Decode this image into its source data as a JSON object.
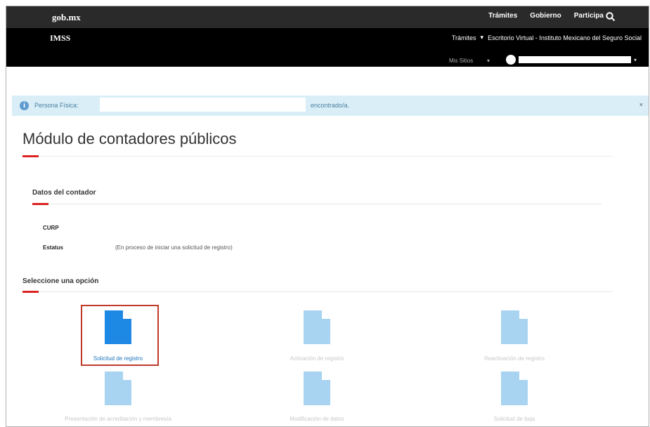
{
  "header": {
    "brand": "gob.mx",
    "nav": [
      "Trámites",
      "Gobierno",
      "Participa"
    ],
    "search_icon": "search-icon"
  },
  "subheader": {
    "title": "IMSS",
    "nav_item": "Trámites",
    "nav_caret": "▾",
    "site_title": "Escritorio Virtual - Instituto Mexicano del Seguro Social",
    "mis_sitios": "Mis Sitios",
    "user_caret": "▾"
  },
  "alert": {
    "icon": "info-icon",
    "label": "Persona Física:",
    "field_value": "",
    "suffix": "encontrado/a.",
    "close": "×"
  },
  "page": {
    "title": "Módulo de contadores públicos"
  },
  "datos": {
    "heading": "Datos del contador",
    "curp_label": "CURP",
    "curp_value": "",
    "estatus_label": "Estatus",
    "estatus_value": "(En proceso de iniciar una solicitud de registro)"
  },
  "options": {
    "heading": "Seleccione una opción",
    "items": [
      {
        "label": "Solicitud de registro",
        "active": true
      },
      {
        "label": "Activación de registro",
        "active": false
      },
      {
        "label": "Reactivación de registro",
        "active": false
      },
      {
        "label": "Presentación de acreditación y membresía",
        "active": false
      },
      {
        "label": "Modificación de datos",
        "active": false
      },
      {
        "label": "Solicitud de baja",
        "active": false
      }
    ]
  },
  "colors": {
    "accent": "#d22222",
    "active_icon": "#1e88e5",
    "inactive_icon": "#a8d4f2",
    "alert_bg": "#d9eef7"
  }
}
